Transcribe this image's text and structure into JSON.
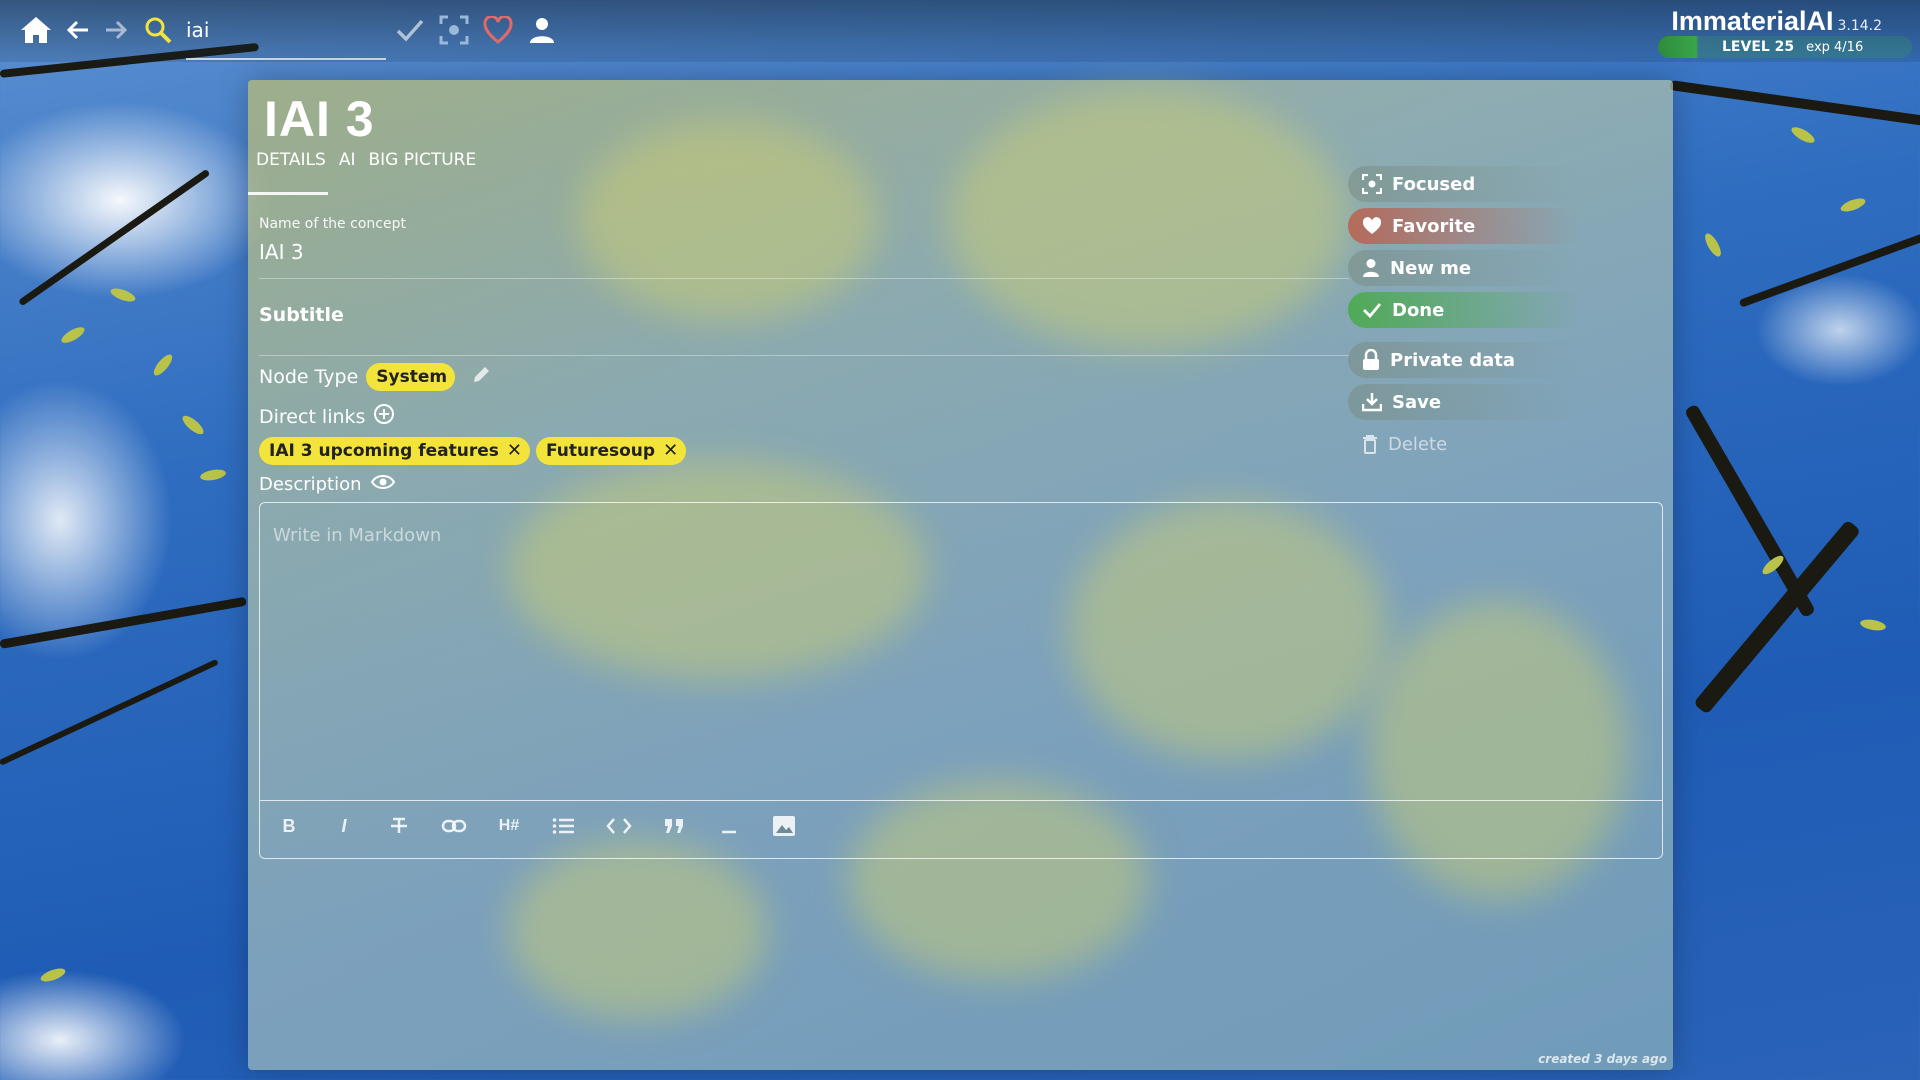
{
  "topbar": {
    "search_value": "iai",
    "icons": [
      "home-icon",
      "arrow-left-icon",
      "arrow-right-icon",
      "search-icon",
      "check-icon",
      "focus-icon",
      "heart-icon",
      "person-icon"
    ]
  },
  "brand": {
    "name": "ImmaterialAI",
    "version": "3.14.2",
    "level": "LEVEL 25",
    "exp": "exp 4/16",
    "exp_progress": 0.25
  },
  "concept": {
    "title": "IAI 3",
    "tabs": [
      "DETAILS",
      "AI",
      "BIG PICTURE"
    ],
    "name_label": "Name of the concept",
    "name_value": "IAI 3",
    "subtitle_label": "Subtitle",
    "node_type_label": "Node Type",
    "node_type_value": "System",
    "direct_links_label": "Direct links",
    "links": [
      "IAI 3 upcoming features",
      "Futuresoup"
    ],
    "description_label": "Description",
    "description_placeholder": "Write in Markdown",
    "created": "created 3 days ago"
  },
  "editor_toolbar": {
    "bold": "B",
    "italic": "I",
    "heading": "H#",
    "tools": [
      "bold",
      "italic",
      "strikethrough",
      "link",
      "heading",
      "list",
      "code",
      "quote",
      "horizontal-rule",
      "image"
    ]
  },
  "actions": {
    "focused": "Focused",
    "favorite": "Favorite",
    "newme": "New me",
    "done": "Done",
    "private": "Private data",
    "save": "Save",
    "delete": "Delete"
  },
  "colors": {
    "chip": "#f3e43c",
    "done": "#46aa46",
    "favorite": "#be5a46",
    "level": "#3aa54a"
  }
}
